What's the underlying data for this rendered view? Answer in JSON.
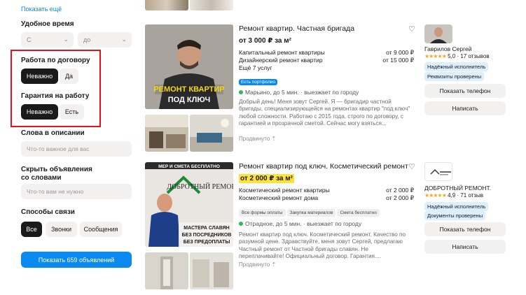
{
  "sidebar": {
    "show_more": "Показать ещё",
    "time_title": "Удобное время",
    "time_from": "С",
    "time_to": "до",
    "contract_title": "Работа по договору",
    "contract_any": "Неважно",
    "contract_yes": "Да",
    "guarantee_title": "Гарантия на работу",
    "guarantee_any": "Неважно",
    "guarantee_yes": "Есть",
    "words_title": "Слова в описании",
    "words_placeholder": "Что-то важное для вас",
    "hide_title_line1": "Скрыть объявления",
    "hide_title_line2": "со словами",
    "hide_placeholder": "Что-то вам не нужно",
    "contact_title": "Способы связи",
    "contact_all": "Все",
    "contact_calls": "Звонки",
    "contact_messages": "Сообщения",
    "show_button": "Показать 659 объявлений"
  },
  "listings": [
    {
      "title": "Ремонт квартир. Частная бригада",
      "price": "от 3 000 ₽ за м²",
      "services": [
        {
          "name": "Капитальный ремонт квартиры",
          "price": "от 9 000 ₽"
        },
        {
          "name": "Дизайнерский ремонт квартир",
          "price": "от 15 000 ₽"
        }
      ],
      "more": "Ещё 7 услуг",
      "tag": "Есть портфолио",
      "location": "Марьино, до 5 мин. · выезжает по городу",
      "description": "Добрый день! Меня зовут Сергей. Я — бригадир частной бригады, специализирующейся на ремонтах квартир \"под ключ\" любой сложности. Работаю с 2015 года, строго по договору, с гарантией и прозрачной сметой. Сейчас могу взяться...",
      "promoted": "Продвинуто",
      "photo_text_line1": "РЕМОНТ КВАРТИР",
      "photo_text_line2": "ПОД КЛЮЧ",
      "seller": {
        "name": "Гаврилов Сергей",
        "rating": "5,0",
        "reviews": "17 отзывов",
        "badges": [
          "Надёжный исполнитель",
          "Реквизиты проверены"
        ],
        "phone_button": "Показать телефон",
        "message_button": "Написать"
      }
    },
    {
      "title": "Ремонт квартир под ключ. Косметический ремонт",
      "price": "от 2 000 ₽ за м²",
      "services": [
        {
          "name": "Косметический ремонт квартиры",
          "price": "от 2 000 ₽"
        },
        {
          "name": "Косметический ремонт дома",
          "price": "от 2 000 ₽"
        }
      ],
      "tags": [
        "Все формы оплаты",
        "Закупка материалов",
        "Смета бесплатно"
      ],
      "location": "Отрадное, до 5 мин. · выезжает по городу",
      "description": "Ремонт квартир под ключ. Косметический ремонт. Качество по разумной цене. Здравствуйте, меня зовут Сергей, предлагаю Частный ремонт от Частной бригады славян. Не переплачивайте! Официальный договор. Гарантия....",
      "promoted": "Продвинуто",
      "photo_text_top": "МЕР И СМЕТА БЕСПЛАТНО",
      "photo_text_brand": "ДОБРОТНЫЙ РЕМОНТ",
      "photo_text_line1": "МАСТЕРА СЛАВЯН",
      "photo_text_line2": "БЕЗ ПОСРЕДНИКОВ",
      "photo_text_line3": "БЕЗ ПРЕДОПЛАТЫ",
      "seller": {
        "name": "ДОБРОТНЫЙ РЕМОНТ.",
        "rating": "4,9",
        "reviews": "71 отзыв",
        "badges": [
          "Надёжный исполнитель",
          "Документы проверены"
        ],
        "phone_button": "Показать телефон",
        "message_button": "Написать"
      }
    }
  ],
  "colors": {
    "accent": "#0a8af0",
    "price_highlight": "#fde23a",
    "filter_highlight": "#e8101b",
    "star": "#f5a623"
  }
}
